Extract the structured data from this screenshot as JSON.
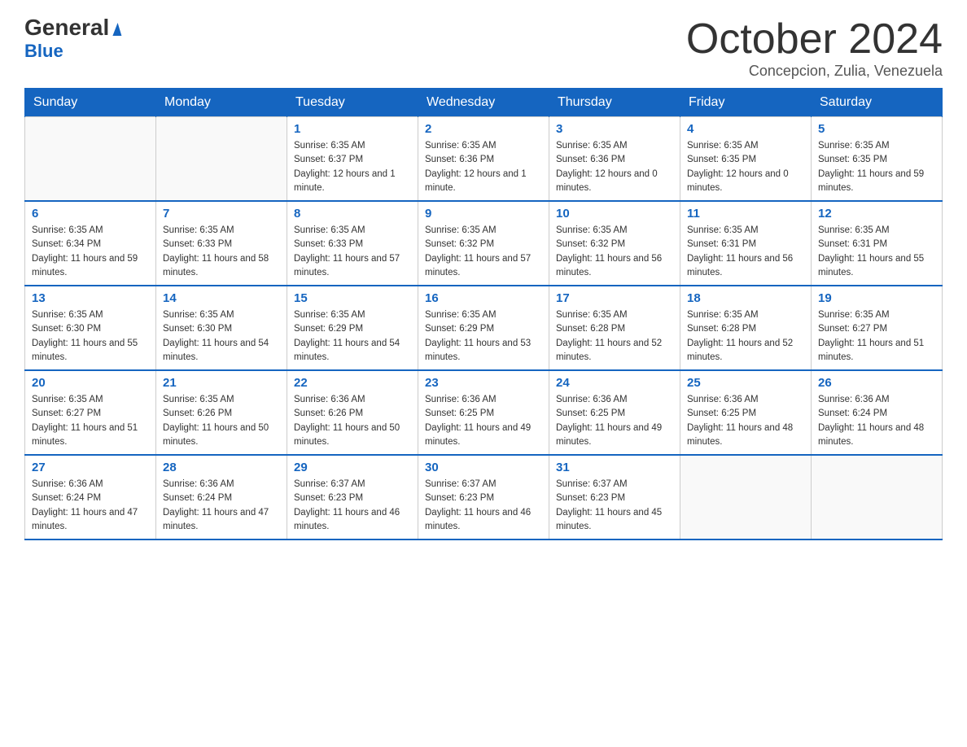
{
  "header": {
    "logo_general": "General",
    "logo_blue": "Blue",
    "title": "October 2024",
    "subtitle": "Concepcion, Zulia, Venezuela"
  },
  "days_of_week": [
    "Sunday",
    "Monday",
    "Tuesday",
    "Wednesday",
    "Thursday",
    "Friday",
    "Saturday"
  ],
  "weeks": [
    [
      {
        "day": "",
        "info": ""
      },
      {
        "day": "",
        "info": ""
      },
      {
        "day": "1",
        "info": "Sunrise: 6:35 AM\nSunset: 6:37 PM\nDaylight: 12 hours and 1 minute."
      },
      {
        "day": "2",
        "info": "Sunrise: 6:35 AM\nSunset: 6:36 PM\nDaylight: 12 hours and 1 minute."
      },
      {
        "day": "3",
        "info": "Sunrise: 6:35 AM\nSunset: 6:36 PM\nDaylight: 12 hours and 0 minutes."
      },
      {
        "day": "4",
        "info": "Sunrise: 6:35 AM\nSunset: 6:35 PM\nDaylight: 12 hours and 0 minutes."
      },
      {
        "day": "5",
        "info": "Sunrise: 6:35 AM\nSunset: 6:35 PM\nDaylight: 11 hours and 59 minutes."
      }
    ],
    [
      {
        "day": "6",
        "info": "Sunrise: 6:35 AM\nSunset: 6:34 PM\nDaylight: 11 hours and 59 minutes."
      },
      {
        "day": "7",
        "info": "Sunrise: 6:35 AM\nSunset: 6:33 PM\nDaylight: 11 hours and 58 minutes."
      },
      {
        "day": "8",
        "info": "Sunrise: 6:35 AM\nSunset: 6:33 PM\nDaylight: 11 hours and 57 minutes."
      },
      {
        "day": "9",
        "info": "Sunrise: 6:35 AM\nSunset: 6:32 PM\nDaylight: 11 hours and 57 minutes."
      },
      {
        "day": "10",
        "info": "Sunrise: 6:35 AM\nSunset: 6:32 PM\nDaylight: 11 hours and 56 minutes."
      },
      {
        "day": "11",
        "info": "Sunrise: 6:35 AM\nSunset: 6:31 PM\nDaylight: 11 hours and 56 minutes."
      },
      {
        "day": "12",
        "info": "Sunrise: 6:35 AM\nSunset: 6:31 PM\nDaylight: 11 hours and 55 minutes."
      }
    ],
    [
      {
        "day": "13",
        "info": "Sunrise: 6:35 AM\nSunset: 6:30 PM\nDaylight: 11 hours and 55 minutes."
      },
      {
        "day": "14",
        "info": "Sunrise: 6:35 AM\nSunset: 6:30 PM\nDaylight: 11 hours and 54 minutes."
      },
      {
        "day": "15",
        "info": "Sunrise: 6:35 AM\nSunset: 6:29 PM\nDaylight: 11 hours and 54 minutes."
      },
      {
        "day": "16",
        "info": "Sunrise: 6:35 AM\nSunset: 6:29 PM\nDaylight: 11 hours and 53 minutes."
      },
      {
        "day": "17",
        "info": "Sunrise: 6:35 AM\nSunset: 6:28 PM\nDaylight: 11 hours and 52 minutes."
      },
      {
        "day": "18",
        "info": "Sunrise: 6:35 AM\nSunset: 6:28 PM\nDaylight: 11 hours and 52 minutes."
      },
      {
        "day": "19",
        "info": "Sunrise: 6:35 AM\nSunset: 6:27 PM\nDaylight: 11 hours and 51 minutes."
      }
    ],
    [
      {
        "day": "20",
        "info": "Sunrise: 6:35 AM\nSunset: 6:27 PM\nDaylight: 11 hours and 51 minutes."
      },
      {
        "day": "21",
        "info": "Sunrise: 6:35 AM\nSunset: 6:26 PM\nDaylight: 11 hours and 50 minutes."
      },
      {
        "day": "22",
        "info": "Sunrise: 6:36 AM\nSunset: 6:26 PM\nDaylight: 11 hours and 50 minutes."
      },
      {
        "day": "23",
        "info": "Sunrise: 6:36 AM\nSunset: 6:25 PM\nDaylight: 11 hours and 49 minutes."
      },
      {
        "day": "24",
        "info": "Sunrise: 6:36 AM\nSunset: 6:25 PM\nDaylight: 11 hours and 49 minutes."
      },
      {
        "day": "25",
        "info": "Sunrise: 6:36 AM\nSunset: 6:25 PM\nDaylight: 11 hours and 48 minutes."
      },
      {
        "day": "26",
        "info": "Sunrise: 6:36 AM\nSunset: 6:24 PM\nDaylight: 11 hours and 48 minutes."
      }
    ],
    [
      {
        "day": "27",
        "info": "Sunrise: 6:36 AM\nSunset: 6:24 PM\nDaylight: 11 hours and 47 minutes."
      },
      {
        "day": "28",
        "info": "Sunrise: 6:36 AM\nSunset: 6:24 PM\nDaylight: 11 hours and 47 minutes."
      },
      {
        "day": "29",
        "info": "Sunrise: 6:37 AM\nSunset: 6:23 PM\nDaylight: 11 hours and 46 minutes."
      },
      {
        "day": "30",
        "info": "Sunrise: 6:37 AM\nSunset: 6:23 PM\nDaylight: 11 hours and 46 minutes."
      },
      {
        "day": "31",
        "info": "Sunrise: 6:37 AM\nSunset: 6:23 PM\nDaylight: 11 hours and 45 minutes."
      },
      {
        "day": "",
        "info": ""
      },
      {
        "day": "",
        "info": ""
      }
    ]
  ]
}
